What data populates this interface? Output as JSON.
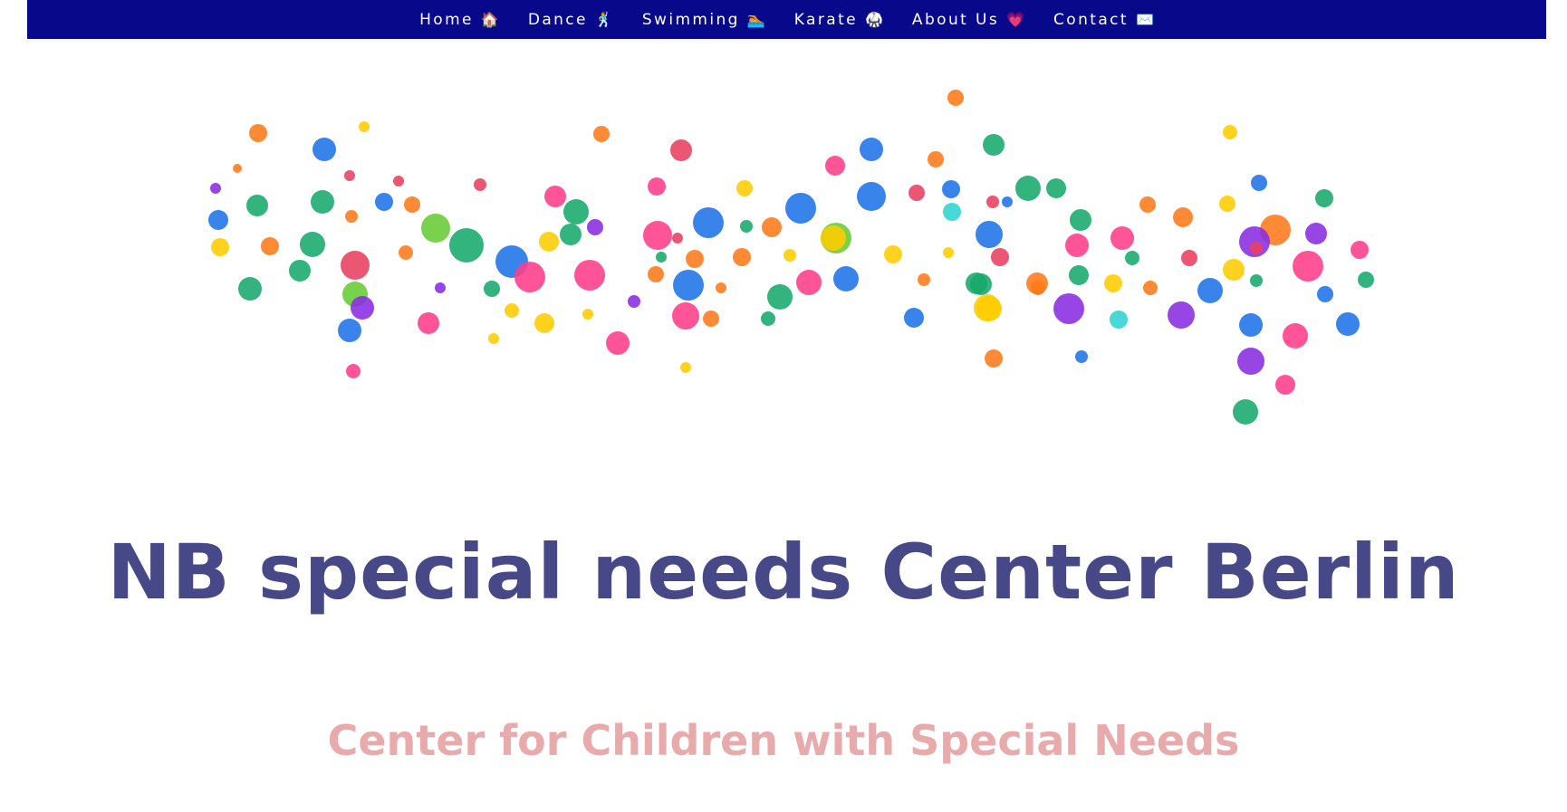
{
  "nav": {
    "items": [
      {
        "label": "Home",
        "emoji": "🏠"
      },
      {
        "label": "Dance",
        "emoji": "🕺"
      },
      {
        "label": "Swimming",
        "emoji": "🏊"
      },
      {
        "label": "Karate",
        "emoji": "🥋"
      },
      {
        "label": "About Us",
        "emoji": "💗"
      },
      {
        "label": "Contact",
        "emoji": "✉️"
      }
    ]
  },
  "hero": {
    "title": "NB special needs Center Berlin",
    "subtitle": "Center for Children with Special Needs"
  },
  "colors": {
    "nav_background": "#08088a",
    "title": "#464888",
    "subtitle": "#e8aaaa",
    "dot_palette": [
      "#ff7a1a",
      "#1e73e8",
      "#17a86b",
      "#ff3d8a",
      "#ffcc00",
      "#8a2be2",
      "#2dd4cf",
      "#ff4444",
      "#66cc33",
      "#e84060"
    ]
  }
}
